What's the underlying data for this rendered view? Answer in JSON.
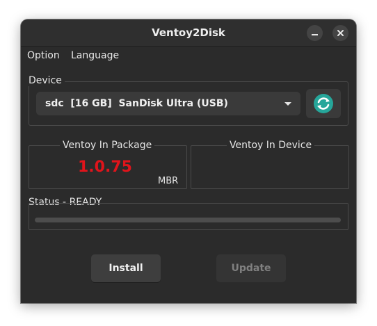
{
  "window": {
    "title": "Ventoy2Disk"
  },
  "menu": {
    "option_label": "Option",
    "language_label": "Language"
  },
  "device": {
    "group_label": "Device",
    "selected": "sdc  [16 GB]  SanDisk Ultra (USB)",
    "refresh_icon": "refresh-icon"
  },
  "package": {
    "group_label": "Ventoy In Package",
    "version": "1.0.75",
    "style": "MBR"
  },
  "installed": {
    "group_label": "Ventoy In Device",
    "version": ""
  },
  "status": {
    "label": "Status - READY",
    "progress_percent": 0
  },
  "buttons": {
    "install_label": "Install",
    "update_label": "Update"
  },
  "colors": {
    "version_red": "#e0141b",
    "refresh_teal": "#26a69a",
    "window_bg": "#2b2b2b"
  }
}
